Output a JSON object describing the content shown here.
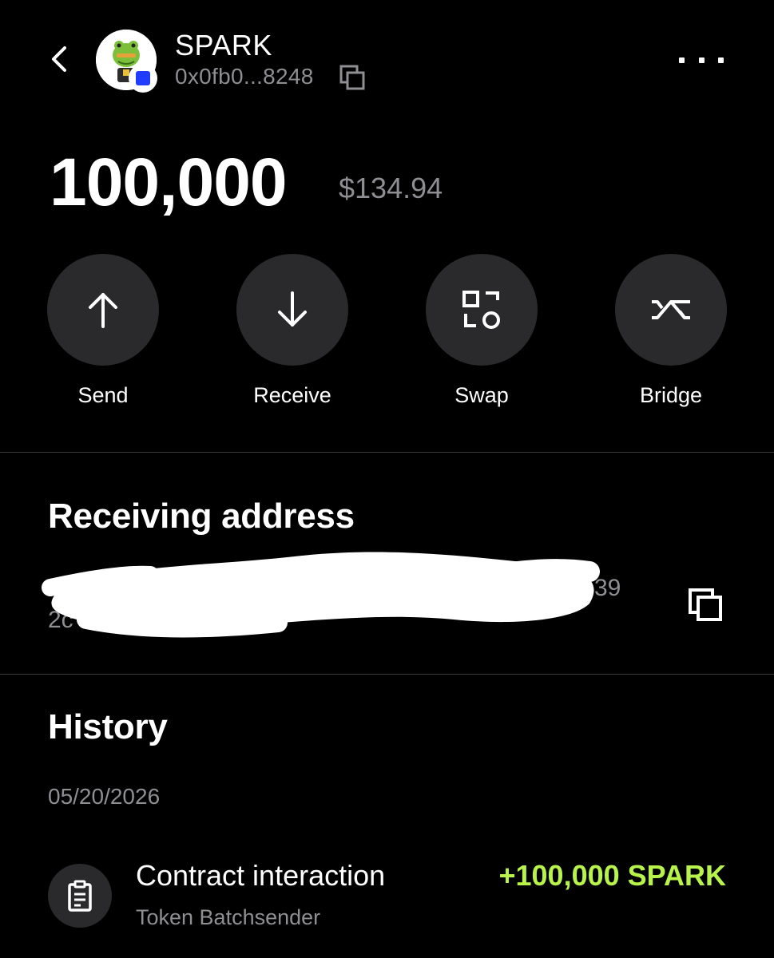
{
  "header": {
    "token_name": "SPARK",
    "token_address_short": "0x0fb0...8248",
    "chain_badge_color": "#1f3cff"
  },
  "balance": {
    "amount": "100,000",
    "usd_value": "$134.94"
  },
  "actions": [
    {
      "label": "Send",
      "icon": "arrow-up-icon"
    },
    {
      "label": "Receive",
      "icon": "arrow-down-icon"
    },
    {
      "label": "Swap",
      "icon": "swap-icon"
    },
    {
      "label": "Bridge",
      "icon": "bridge-icon"
    }
  ],
  "receiving": {
    "title": "Receiving address",
    "line1_visible_suffix": "39",
    "line2_visible_prefix": "2c",
    "redacted": true
  },
  "history": {
    "title": "History",
    "groups": [
      {
        "date": "05/20/2026",
        "transactions": [
          {
            "title": "Contract interaction",
            "subtitle": "Token Batchsender",
            "amount": "+100,000 SPARK",
            "amount_color": "#b7f34a",
            "icon": "clipboard-icon"
          }
        ]
      }
    ]
  },
  "colors": {
    "background": "#000000",
    "secondary_text": "#8e8e93",
    "button_bg": "#2a2a2c",
    "positive": "#b7f34a"
  }
}
